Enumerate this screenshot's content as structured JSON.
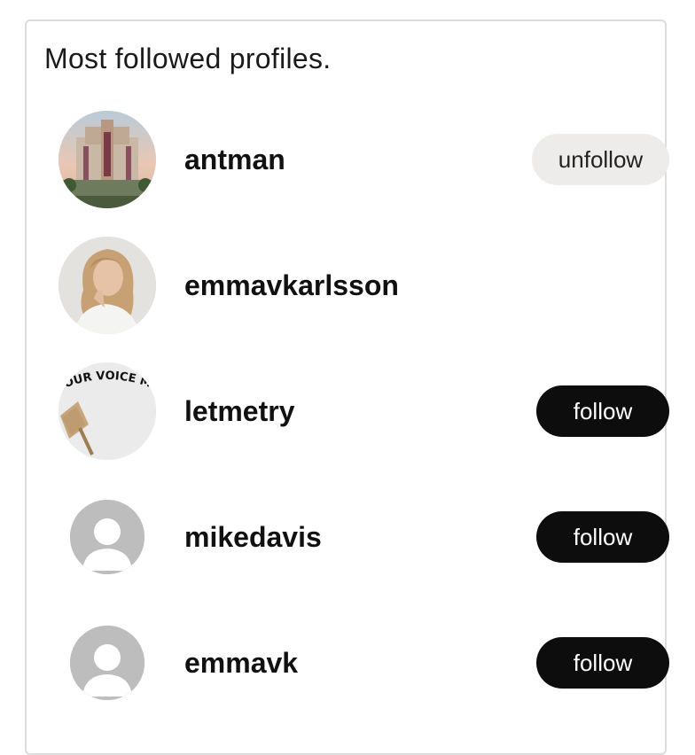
{
  "panel": {
    "title": "Most followed profiles."
  },
  "profiles": [
    {
      "username": "antman",
      "avatar_icon": "building-photo-avatar",
      "action_label": "unfollow",
      "action": "unfollow"
    },
    {
      "username": "emmavkarlsson",
      "avatar_icon": "woman-portrait-avatar",
      "action_label": "",
      "action": "none"
    },
    {
      "username": "letmetry",
      "avatar_icon": "protest-sign-avatar",
      "avatar_text": "OUR VOICE MATTERS",
      "action_label": "follow",
      "action": "follow"
    },
    {
      "username": "mikedavis",
      "avatar_icon": "default-user-avatar",
      "action_label": "follow",
      "action": "follow"
    },
    {
      "username": "emmavk",
      "avatar_icon": "default-user-avatar",
      "action_label": "follow",
      "action": "follow"
    }
  ],
  "colors": {
    "follow_button_bg": "#0d0d0d",
    "follow_button_text": "#ffffff",
    "unfollow_button_bg": "#eeeceb",
    "default_avatar_bg": "#bdbdbd",
    "card_border": "#dcdcdc"
  }
}
